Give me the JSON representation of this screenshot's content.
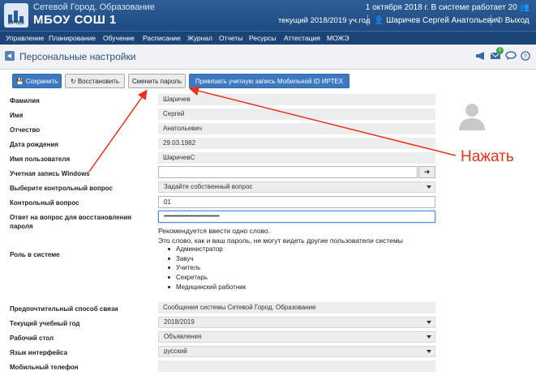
{
  "header": {
    "logo_text": "ИРТЕХ",
    "system_name": "Сетевой Город. Образование",
    "school": "МБОУ СОШ 1",
    "date_status": "1 октября 2018 г.  В системе работает 20",
    "year": "текущий 2018/2019 уч.год",
    "user": "Шаричев Сергей Анатольевич",
    "exit": "Выход"
  },
  "menu": [
    "Управление",
    "Планирование",
    "Обучение",
    "Расписание",
    "Журнал",
    "Отчеты",
    "Ресурсы",
    "Аттестация",
    "МОЖЭ"
  ],
  "page": {
    "title": "Персональные настройки",
    "badge": "1"
  },
  "toolbar": {
    "save": "Сохранить",
    "restore": "Восстановить",
    "change_password": "Сменить пароль",
    "bind_mobile": "Привязать учетную запись Мобильной ID ИРТЕХ"
  },
  "form": {
    "surname": {
      "label": "Фамилия",
      "value": "Шаричев"
    },
    "name": {
      "label": "Имя",
      "value": "Сергей"
    },
    "patronymic": {
      "label": "Отчество",
      "value": "Анатольевич"
    },
    "birthdate": {
      "label": "Дата рождения",
      "value": "29.03.1982"
    },
    "username": {
      "label": "Имя пользователя",
      "value": "ШаричевС"
    },
    "windows": {
      "label": "Учетная запись Windows",
      "value": ""
    },
    "question_select": {
      "label": "Выберите контрольный вопрос",
      "value": "Задайте собственный вопрос"
    },
    "question": {
      "label": "Контрольный вопрос",
      "value": "01"
    },
    "answer": {
      "label1": "Ответ на вопрос для восстановления",
      "label2": "пароля",
      "value": "•••••••••••••••••••••••••••••••••••"
    },
    "hint1": "Рекомендуется ввести одно слово.",
    "hint2": "Это слово, как и ваш пароль, не могут видеть другие пользователи системы",
    "roles_label": "Роль в системе",
    "roles": [
      "Администратор",
      "Завуч",
      "Учитель",
      "Секретарь",
      "Медицинский работник"
    ],
    "contact": {
      "label": "Предпочтительный способ связи",
      "value": "Сообщения системы Сетевой Город. Образование"
    },
    "school_year": {
      "label": "Текущий учебный год",
      "value": "2018/2019"
    },
    "desktop": {
      "label": "Рабочий стол",
      "value": "Объявления"
    },
    "language": {
      "label": "Язык интерфейса",
      "value": "русский"
    },
    "mobile": {
      "label": "Мобильный телефон",
      "value": ""
    }
  },
  "annotation": "Нажать",
  "colors": {
    "header": "#1f4a80",
    "menu": "#1b4477",
    "accent": "#3d79c2",
    "annotation": "#e8321e"
  }
}
